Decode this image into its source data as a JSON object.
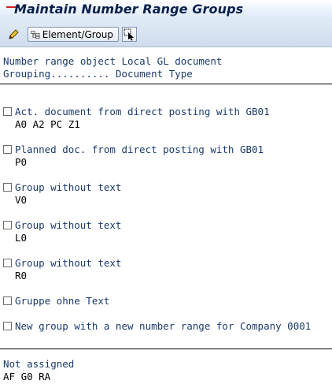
{
  "window": {
    "title": "Maintain Number Range Groups"
  },
  "toolbar": {
    "edit_icon": "pencil-icon",
    "element_group_label": "Element/Group",
    "element_group_icon": "hierarchy-icon",
    "select_icon": "cursor-select-icon"
  },
  "header": {
    "line1": "Number range object Local GL document",
    "line2": "Grouping.......... Document Type"
  },
  "groups": [
    {
      "label": "Act. document from direct posting with GB01",
      "elements": "A0 A2 PC Z1",
      "checked": false
    },
    {
      "label": "Planned doc. from direct posting with GB01",
      "elements": "P0",
      "checked": false
    },
    {
      "label": "Group without text",
      "elements": "V0",
      "checked": false
    },
    {
      "label": "Group without text",
      "elements": "L0",
      "checked": false
    },
    {
      "label": "Group without text",
      "elements": "R0",
      "checked": false
    },
    {
      "label": "Gruppe ohne Text",
      "elements": "",
      "checked": false
    },
    {
      "label": "New group with a new number range for Company 0001",
      "elements": "",
      "checked": false
    }
  ],
  "not_assigned": {
    "label": "Not assigned",
    "elements": "AF G0 RA"
  },
  "colors": {
    "title_text": "#0a1f4a",
    "label_blue": "#1b3a6b",
    "toolbar_bg": "#cfdcec"
  }
}
